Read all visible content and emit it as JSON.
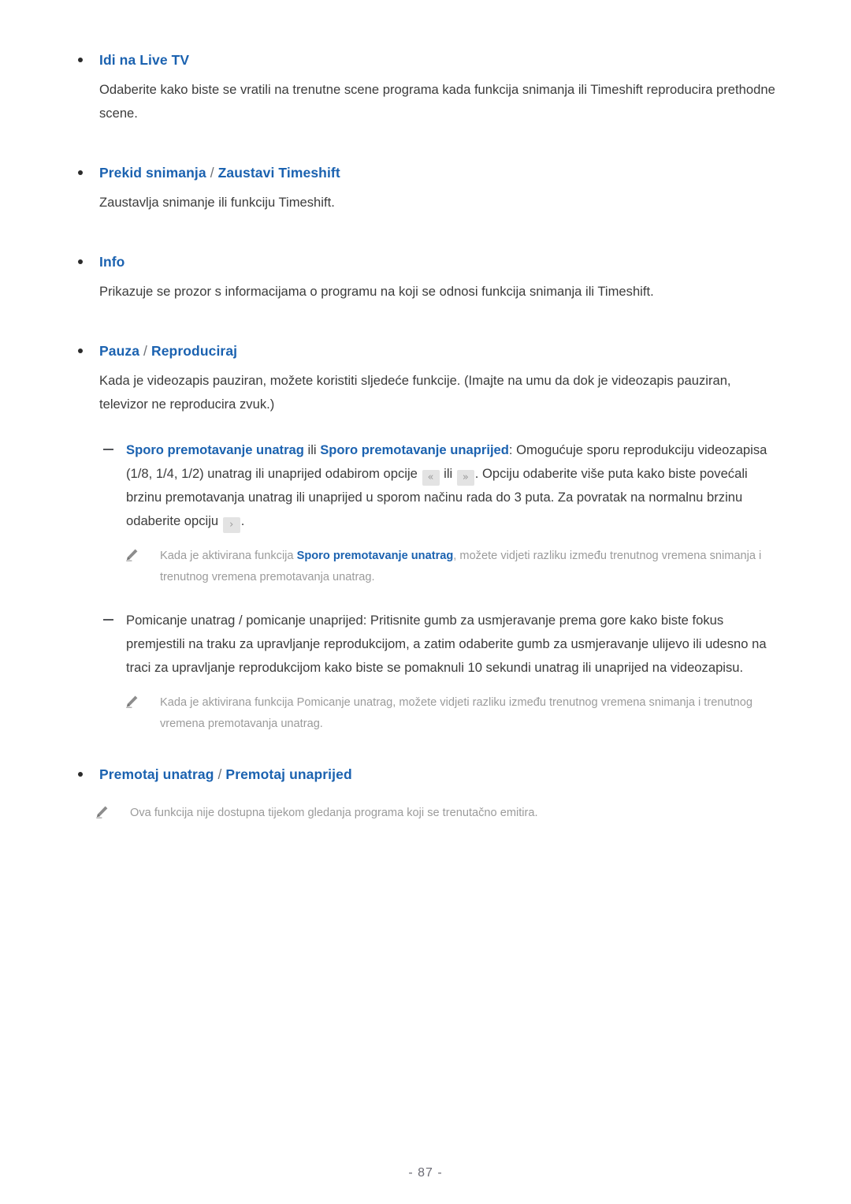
{
  "page": {
    "number_label": "- 87 -"
  },
  "icons": {
    "pencil": "pencil-icon",
    "rewind": "rewind-double-chevron-icon",
    "fast_forward": "fast-forward-double-chevron-icon",
    "play": "play-chevron-icon"
  },
  "colors": {
    "link_blue": "#1b62b0",
    "body_text": "#3c3c3c",
    "note_text": "#9b9b9b",
    "separator": "#6f7277",
    "key_icon_bg": "#e3e3e3",
    "background": "#ffffff"
  },
  "sections": [
    {
      "heading": {
        "terms": [
          "Idi na Live TV"
        ],
        "separator": ""
      },
      "paragraph": "Odaberite kako biste se vratili na trenutne scene programa kada funkcija snimanja ili Timeshift reproducira prethodne scene."
    },
    {
      "heading": {
        "terms": [
          "Prekid snimanja",
          "Zaustavi Timeshift"
        ],
        "separator": "/"
      },
      "paragraph": "Zaustavlja snimanje ili funkciju Timeshift."
    },
    {
      "heading": {
        "terms": [
          "Info"
        ],
        "separator": ""
      },
      "paragraph": "Prikazuje se prozor s informacijama o programu na koji se odnosi funkcija snimanja ili Timeshift."
    },
    {
      "heading": {
        "terms": [
          "Pauza",
          "Reproduciraj"
        ],
        "separator": "/"
      },
      "paragraph": "Kada je videozapis pauziran, možete koristiti sljedeće funkcije. (Imajte na umu da dok je videozapis pauziran, televizor ne reproducira zvuk.)"
    }
  ],
  "subitems": [
    {
      "term_a": "Sporo premotavanje unatrag",
      "conjunction": " ili ",
      "term_b": "Sporo premotavanje unaprijed",
      "text_1": ": Omogućuje sporu reprodukciju videozapisa (1/8, 1/4, 1/2) unatrag ili unaprijed odabirom opcije ",
      "icon_1": "«",
      "text_2": " ili ",
      "icon_2": "»",
      "text_3": ". Opciju odaberite više puta kako biste povećali brzinu premotavanja unatrag ili unaprijed u sporom načinu rada do 3 puta. Za povratak na normalnu brzinu odaberite opciju ",
      "icon_3": "›",
      "text_4": ".",
      "note": {
        "text_before": "Kada je aktivirana funkcija ",
        "highlight": "Sporo premotavanje unatrag",
        "text_after": ", možete vidjeti razliku između trenutnog vremena snimanja i trenutnog vremena premotavanja unatrag."
      }
    },
    {
      "plain_text": "Pomicanje unatrag / pomicanje unaprijed: Pritisnite gumb za usmjeravanje prema gore kako biste fokus premjestili na traku za upravljanje reprodukcijom, a zatim odaberite gumb za usmjeravanje ulijevo ili udesno na traci za upravljanje reprodukcijom kako biste se pomaknuli 10 sekundi unatrag ili unaprijed na videozapisu.",
      "note": {
        "text_before": "Kada je aktivirana funkcija Pomicanje unatrag, možete vidjeti razliku između trenutnog vremena snimanja i trenutnog vremena premotavanja unatrag.",
        "highlight": "",
        "text_after": ""
      }
    }
  ],
  "final_section": {
    "heading": {
      "terms": [
        "Premotaj unatrag",
        "Premotaj unaprijed"
      ],
      "separator": "/"
    },
    "note": "Ova funkcija nije dostupna tijekom gledanja programa koji se trenutačno emitira."
  }
}
